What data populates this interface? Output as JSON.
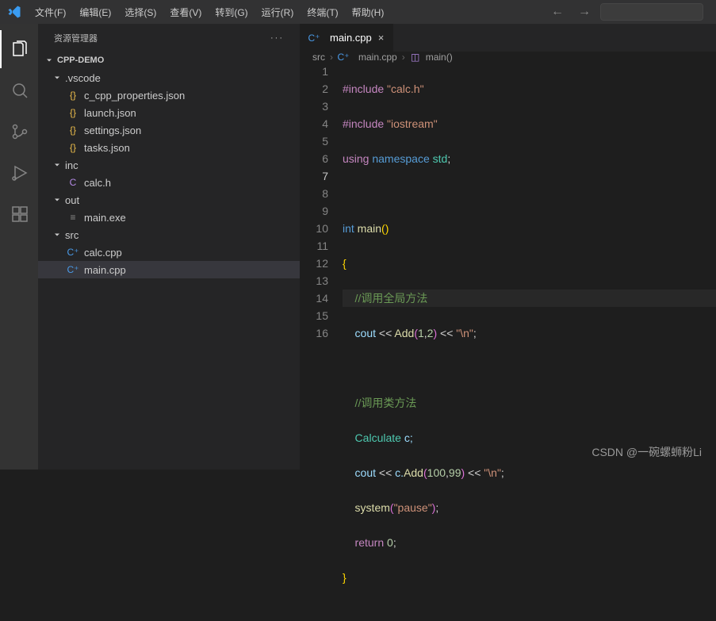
{
  "menu": {
    "file": "文件(F)",
    "edit": "编辑(E)",
    "select": "选择(S)",
    "view": "查看(V)",
    "go": "转到(G)",
    "run": "运行(R)",
    "terminal": "终端(T)",
    "help": "帮助(H)"
  },
  "sidebar": {
    "title": "资源管理器",
    "project": "CPP-DEMO"
  },
  "tree": {
    "vscode": ".vscode",
    "vscode_files": [
      "c_cpp_properties.json",
      "launch.json",
      "settings.json",
      "tasks.json"
    ],
    "inc": "inc",
    "inc_files": [
      "calc.h"
    ],
    "out": "out",
    "out_files": [
      "main.exe"
    ],
    "src": "src",
    "src_files": [
      "calc.cpp",
      "main.cpp"
    ]
  },
  "tab": {
    "name": "main.cpp"
  },
  "breadcrumb": {
    "src": "src",
    "file": "main.cpp",
    "fn": "main()"
  },
  "code": {
    "l1a": "#include",
    "l1b": " \"calc.h\"",
    "l2a": "#include",
    "l2b": " \"iostream\"",
    "l3a": "using",
    "l3b": " namespace",
    "l3c": " std",
    "l3d": ";",
    "l5a": "int",
    "l5b": " main",
    "l5c": "()",
    "l6": "{",
    "l7": "    //调用全局方法",
    "l8a": "    cout ",
    "l8b": "<<",
    "l8c": " Add",
    "l8d": "(",
    "l8e": "1",
    "l8f": ",",
    "l8g": "2",
    "l8h": ")",
    "l8i": " << ",
    "l8j": "\"\\n\"",
    "l8k": ";",
    "l10": "    //调用类方法",
    "l11a": "    Calculate",
    "l11b": " c;",
    "l12a": "    cout ",
    "l12b": "<<",
    "l12c": " c.",
    "l12d": "Add",
    "l12e": "(",
    "l12f": "100",
    "l12g": ",",
    "l12h": "99",
    "l12i": ")",
    "l12j": " << ",
    "l12k": "\"\\n\"",
    "l12l": ";",
    "l13a": "    system",
    "l13b": "(",
    "l13c": "\"pause\"",
    "l13d": ")",
    "l13e": ";",
    "l14a": "    return ",
    "l14b": "0",
    "l14c": ";",
    "l15": "}"
  },
  "watermark": "CSDN @一碗螺蛳粉Li"
}
